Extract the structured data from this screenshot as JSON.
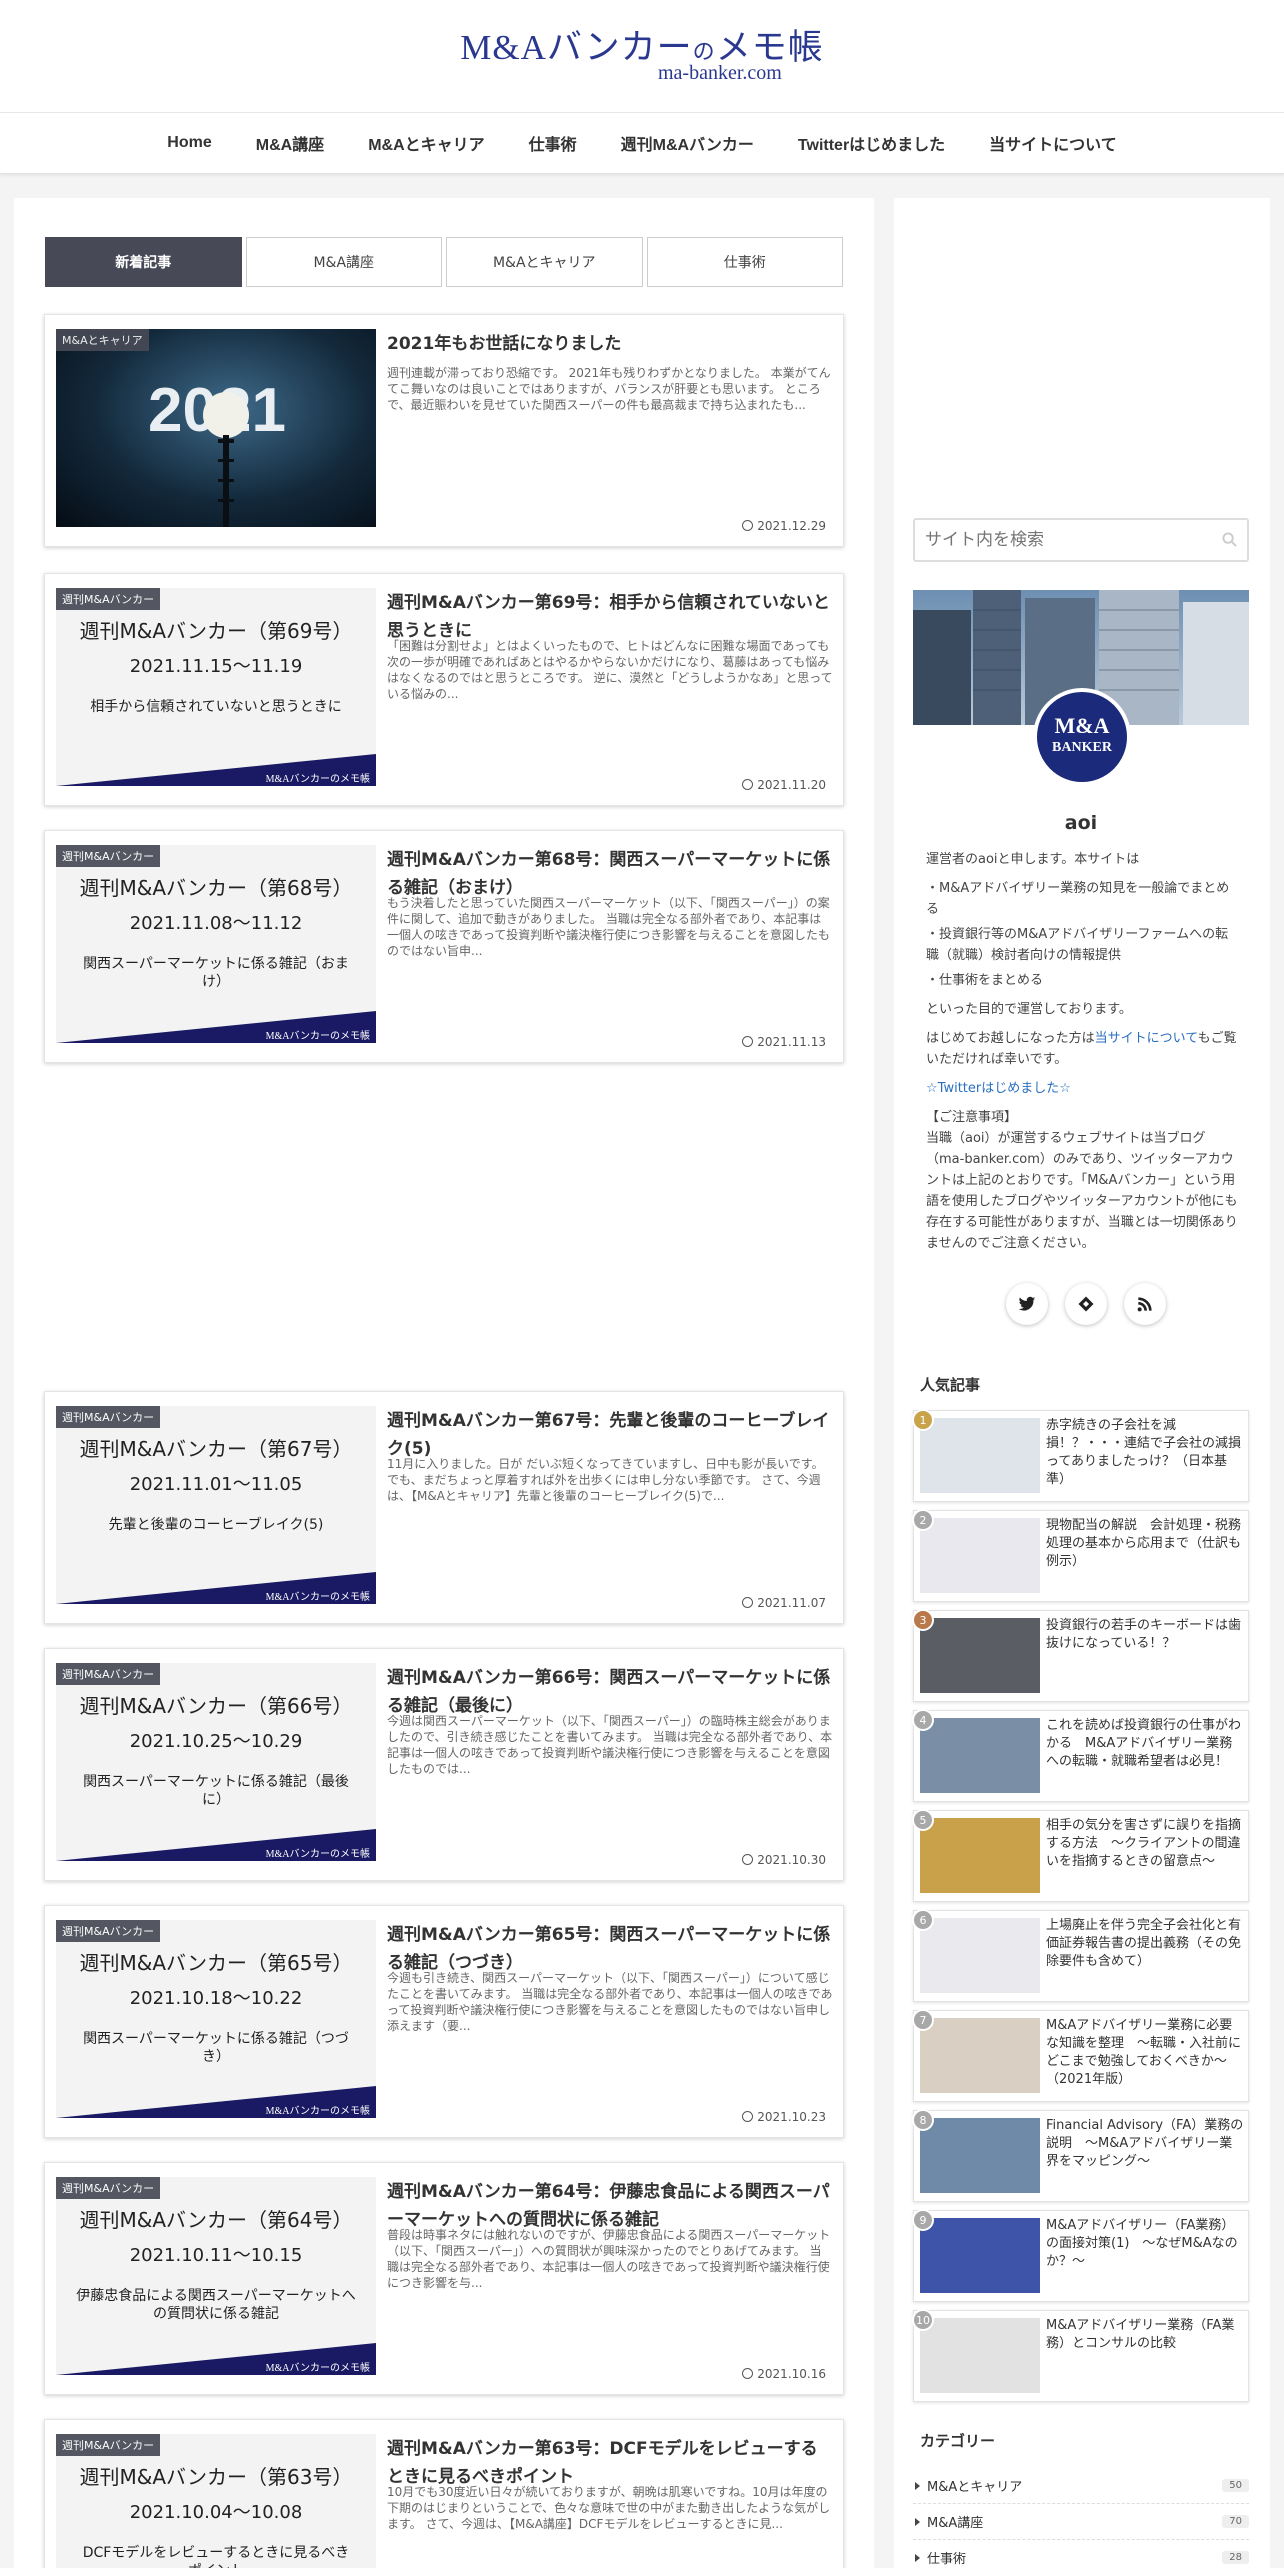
{
  "site": {
    "logo_main": "M&Aバンカー",
    "logo_no": "の",
    "logo_tail": "メモ帳",
    "logo_sub": "ma-banker.com"
  },
  "nav": [
    "Home",
    "M&A講座",
    "M&Aとキャリア",
    "仕事術",
    "週刊M&Aバンカー",
    "Twitterはじめました",
    "当サイトについて"
  ],
  "tabs": [
    "新着記事",
    "M&A講座",
    "M&Aとキャリア",
    "仕事術"
  ],
  "thumb_brand": "M&Aバンカーのメモ帳",
  "posts": [
    {
      "category": "M&Aとキャリア",
      "moon_text": "2021",
      "title": "2021年もお世話になりました",
      "excerpt": "週刊連載が滞っており恐縮です。 2021年も残りわずかとなりました。 本業がてんてこ舞いなのは良いことではありますが、バランスが肝要とも思います。 ところで、最近賑わいを見せていた関西スーパーの件も最高裁まで持ち込まれたも...",
      "date": "2021.12.29"
    },
    {
      "category": "週刊M&Aバンカー",
      "issue": "週刊M&Aバンカー（第69号）",
      "period": "2021.11.15～11.19",
      "topic": "相手から信頼されていないと思うときに",
      "title": "週刊M&Aバンカー第69号：相手から信頼されていないと思うときに",
      "excerpt": "「困難は分割せよ」とはよくいったもので、ヒトはどんなに困難な場面であっても次の一歩が明確であればあとはやるかやらないかだけになり、葛藤はあっても悩みはなくなるのではと思うところです。 逆に、漠然と「どうしようかなあ」と思っている悩みの...",
      "date": "2021.11.20"
    },
    {
      "category": "週刊M&Aバンカー",
      "issue": "週刊M&Aバンカー（第68号）",
      "period": "2021.11.08～11.12",
      "topic": "関西スーパーマーケットに係る雑記（おまけ）",
      "title": "週刊M&Aバンカー第68号：関西スーパーマーケットに係る雑記（おまけ）",
      "excerpt": "もう決着したと思っていた関西スーパーマーケット（以下、「関西スーパー」）の案件に関して、追加で動きがありました。 当職は完全なる部外者であり、本記事は一個人の呟きであって投資判断や議決権行使につき影響を与えることを意図したものではない旨申...",
      "date": "2021.11.13"
    },
    {
      "category": "週刊M&Aバンカー",
      "issue": "週刊M&Aバンカー（第67号）",
      "period": "2021.11.01～11.05",
      "topic": "先輩と後輩のコーヒーブレイク(5)",
      "title": "週刊M&Aバンカー第67号：先輩と後輩のコーヒーブレイク(5)",
      "excerpt": "11月に入りました。日が だいぶ短くなってきていますし、日中も影が長いです。 でも、まだちょっと厚着すれば外を出歩くには申し分ない季節です。 さて、今週は、【M&Aとキャリア】先輩と後輩のコーヒーブレイク(5)で...",
      "date": "2021.11.07"
    },
    {
      "category": "週刊M&Aバンカー",
      "issue": "週刊M&Aバンカー（第66号）",
      "period": "2021.10.25～10.29",
      "topic": "関西スーパーマーケットに係る雑記（最後に）",
      "title": "週刊M&Aバンカー第66号：関西スーパーマーケットに係る雑記（最後に）",
      "excerpt": "今週は関西スーパーマーケット（以下、「関西スーパー」）の臨時株主総会がありましたので、引き続き感じたことを書いてみます。 当職は完全なる部外者であり、本記事は一個人の呟きであって投資判断や議決権行使につき影響を与えることを意図したものでは...",
      "date": "2021.10.30"
    },
    {
      "category": "週刊M&Aバンカー",
      "issue": "週刊M&Aバンカー（第65号）",
      "period": "2021.10.18～10.22",
      "topic": "関西スーパーマーケットに係る雑記（つづき）",
      "title": "週刊M&Aバンカー第65号：関西スーパーマーケットに係る雑記（つづき）",
      "excerpt": "今週も引き続き、関西スーパーマーケット（以下、「関西スーパー」）について感じたことを書いてみます。 当職は完全なる部外者であり、本記事は一個人の呟きであって投資判断や議決権行使につき影響を与えることを意図したものではない旨申し添えます（要...",
      "date": "2021.10.23"
    },
    {
      "category": "週刊M&Aバンカー",
      "issue": "週刊M&Aバンカー（第64号）",
      "period": "2021.10.11～10.15",
      "topic": "伊藤忠食品による関西スーパーマーケットへの質問状に係る雑記",
      "title": "週刊M&Aバンカー第64号：伊藤忠食品による関西スーパーマーケットへの質問状に係る雑記",
      "excerpt": "普段は時事ネタには触れないのですが、伊藤忠食品による関西スーパーマーケット（以下、「関西スーパー」）への質問状が興味深かったのでとりあげてみます。 当職は完全なる部外者であり、本記事は一個人の呟きであって投資判断や議決権行使につき影響を与...",
      "date": "2021.10.16"
    },
    {
      "category": "週刊M&Aバンカー",
      "issue": "週刊M&Aバンカー（第63号）",
      "period": "2021.10.04～10.08",
      "topic": "DCFモデルをレビューするときに見るべきポイント",
      "title": "週刊M&Aバンカー第63号：DCFモデルをレビューするときに見るべきポイント",
      "excerpt": "10月でも30度近い日々が続いておりますが、朝晩は肌寒いですね。10月は年度の下期のはじまりということで、色々な意味で世の中がまた動き出したような気がします。 さて、今週は、【M&A講座】DCFモデルをレビューするときに見...",
      "date": ""
    }
  ],
  "sidebar": {
    "search_placeholder": "サイト内を検索",
    "avatar_line1": "M&A",
    "avatar_line2": "BANKER",
    "author": "aoi",
    "bio_intro": "運営者のaoiと申します。本サイトは",
    "bio_points": [
      "・M&Aアドバイザリー業務の知見を一般論でまとめる",
      "・投資銀行等のM&Aアドバイザリーファームへの転職（就職）検討者向けの情報提供",
      "・仕事術をまとめる"
    ],
    "bio_purpose": "といった目的で運営しております。",
    "bio_first_pre": "はじめてお越しになった方は",
    "bio_first_link": "当サイトについて",
    "bio_first_post": "もご覧いただければ幸いです。",
    "twitter_link": "☆Twitterはじめました☆",
    "notice_title": "【ご注意事項】",
    "notice_body": "当職（aoi）が運営するウェブサイトは当ブログ（ma-banker.com）のみであり、ツイッターアカウントは上記のとおりです。「M&Aバンカー」という用語を使用したブログやツイッターアカウントが他にも存在する可能性がありますが、当職とは一切関係ありませんのでご注意ください。",
    "popular_title": "人気記事",
    "popular": [
      {
        "n": "1",
        "color": "#c8a34a",
        "title": "赤字続きの子会社を減損！？・・・連結で子会社の減損ってありましたっけ？（日本基準）"
      },
      {
        "n": "2",
        "color": "#a8a8a8",
        "title": "現物配当の解説　会計処理・税務処理の基本から応用まで（仕訳も例示）"
      },
      {
        "n": "3",
        "color": "#b9794b",
        "title": "投資銀行の若手のキーボードは歯抜けになっている！？"
      },
      {
        "n": "4",
        "color": "#a8a8a8",
        "title": "これを読めば投資銀行の仕事がわかる　M&Aアドバイザリー業務への転職・就職希望者は必見！"
      },
      {
        "n": "5",
        "color": "#a8a8a8",
        "title": "相手の気分を害さずに誤りを指摘する方法　〜クライアントの間違いを指摘するときの留意点〜"
      },
      {
        "n": "6",
        "color": "#a8a8a8",
        "title": "上場廃止を伴う完全子会社化と有価証券報告書の提出義務（その免除要件も含めて）"
      },
      {
        "n": "7",
        "color": "#a8a8a8",
        "title": "M&Aアドバイザリー業務に必要な知識を整理　〜転職・入社前にどこまで勉強しておくべきか〜（2021年版）"
      },
      {
        "n": "8",
        "color": "#a8a8a8",
        "title": "Financial Advisory（FA）業務の説明　〜M&Aアドバイザリー業界をマッピング〜"
      },
      {
        "n": "9",
        "color": "#a8a8a8",
        "title": "M&Aアドバイザリー（FA業務）の面接対策(1)　〜なぜM&Aなのか？〜"
      },
      {
        "n": "10",
        "color": "#a8a8a8",
        "title": "M&Aアドバイザリー業務（FA業務）とコンサルの比較"
      }
    ],
    "categories_title": "カテゴリー",
    "categories": [
      {
        "name": "M&Aとキャリア",
        "count": "50"
      },
      {
        "name": "M&A講座",
        "count": "70"
      },
      {
        "name": "仕事術",
        "count": "28"
      }
    ]
  }
}
